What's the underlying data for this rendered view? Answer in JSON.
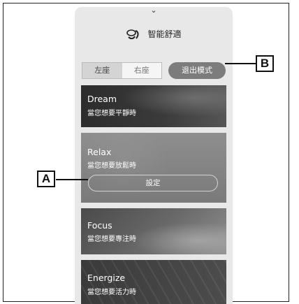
{
  "header": {
    "title": "智能舒適",
    "handle": "⌄"
  },
  "seats": {
    "left": "左座",
    "right": "右座"
  },
  "exit_button": "退出模式",
  "cards": [
    {
      "name": "Dream",
      "subtitle": "當您想要平靜時"
    },
    {
      "name": "Relax",
      "subtitle": "當您想要放鬆時",
      "action": "設定"
    },
    {
      "name": "Focus",
      "subtitle": "當您想要專注時"
    },
    {
      "name": "Energize",
      "subtitle": "當您想要活力時"
    }
  ],
  "callouts": {
    "a": "A",
    "b": "B"
  }
}
